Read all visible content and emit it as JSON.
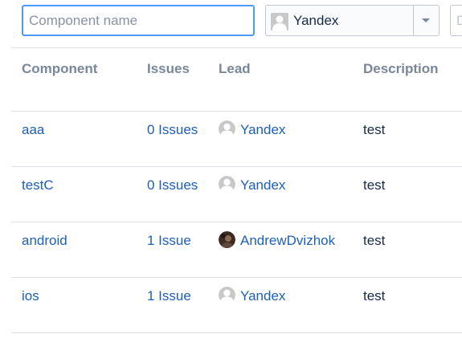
{
  "filters": {
    "name_placeholder": "Component name",
    "lead_value": "Yandex",
    "third_placeholder": "D"
  },
  "columns": {
    "component": "Component",
    "issues": "Issues",
    "lead": "Lead",
    "description": "Description"
  },
  "rows": [
    {
      "component": "aaa",
      "issues": "0 Issues",
      "lead": "Yandex",
      "lead_avatar": "default-avatar-icon",
      "description": "test"
    },
    {
      "component": "testC",
      "issues": "0 Issues",
      "lead": "Yandex",
      "lead_avatar": "default-avatar-icon",
      "description": "test"
    },
    {
      "component": "android",
      "issues": "1 Issue",
      "lead": "AndrewDvizhok",
      "lead_avatar": "photo-avatar",
      "description": "test"
    },
    {
      "component": "ios",
      "issues": "1 Issue",
      "lead": "Yandex",
      "lead_avatar": "default-avatar-icon",
      "description": "test"
    }
  ],
  "colors": {
    "link": "#1d5fb9",
    "header_text": "#7a869a",
    "focus_border": "#4c9aff",
    "divider": "#dfe1e6"
  }
}
